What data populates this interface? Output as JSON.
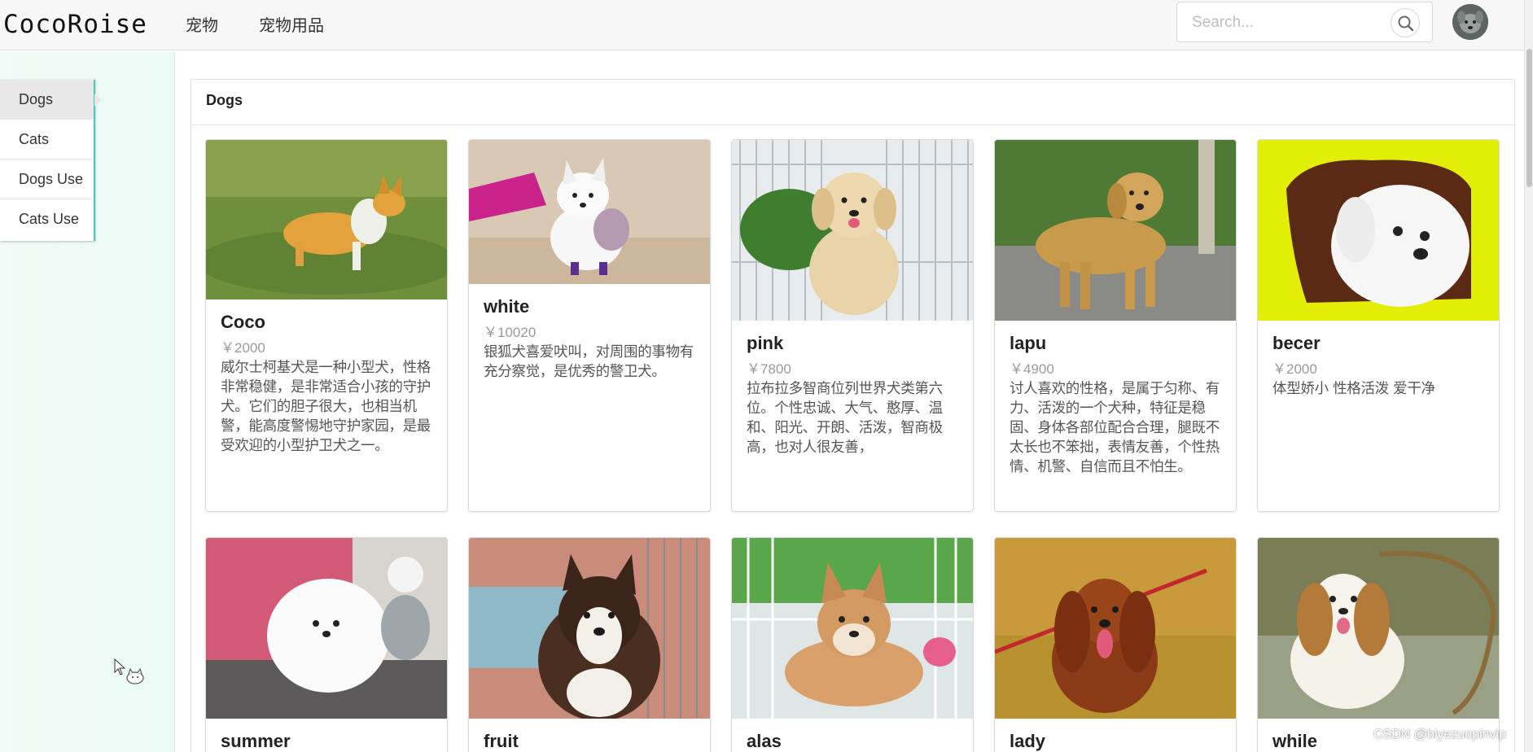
{
  "header": {
    "logo": "CocoRoise",
    "nav": [
      "宠物",
      "宠物用品"
    ],
    "search_placeholder": "Search..."
  },
  "sidebar": {
    "items": [
      {
        "label": "Dogs",
        "active": true
      },
      {
        "label": "Cats",
        "active": false
      },
      {
        "label": "Dogs Use",
        "active": false
      },
      {
        "label": "Cats Use",
        "active": false
      }
    ]
  },
  "main": {
    "title": "Dogs",
    "cards": [
      {
        "name": "Coco",
        "price": "￥2000",
        "desc": "威尔士柯基犬是一种小型犬，性格非常稳健，是非常适合小孩的守护犬。它们的胆子很大，也相当机警，能高度警惕地守护家园，是最受欢迎的小型护卫犬之一。",
        "photo": "corgi-photo"
      },
      {
        "name": "white",
        "price": "￥10020",
        "desc": "银狐犬喜爱吠叫，对周围的事物有充分察觉，是优秀的警卫犬。",
        "photo": "spitz-photo"
      },
      {
        "name": "pink",
        "price": "￥7800",
        "desc": "拉布拉多智商位列世界犬类第六位。个性忠诚、大气、憨厚、温和、阳光、开朗、活泼，智商极高，也对人很友善，",
        "photo": "labrador-puppy-photo"
      },
      {
        "name": "lapu",
        "price": "￥4900",
        "desc": "讨人喜欢的性格，是属于匀称、有力、活泼的一个犬种，特征是稳固、身体各部位配合合理，腿既不太长也不笨拙，表情友善，个性热情、机警、自信而且不怕生。",
        "photo": "golden-retriever-photo"
      },
      {
        "name": "becer",
        "price": "￥2000",
        "desc": "体型娇小 性格活泼 爱干净",
        "photo": "bichon-photo"
      },
      {
        "name": "summer",
        "price": "",
        "desc": "",
        "photo": "pomeranian-photo"
      },
      {
        "name": "fruit",
        "price": "",
        "desc": "",
        "photo": "malamute-photo"
      },
      {
        "name": "alas",
        "price": "",
        "desc": "",
        "photo": "shiba-photo"
      },
      {
        "name": "lady",
        "price": "",
        "desc": "",
        "photo": "cocker-spaniel-photo"
      },
      {
        "name": "while",
        "price": "",
        "desc": "",
        "photo": "cavalier-photo"
      }
    ]
  },
  "watermark": "CSDN @biyezuopinvip",
  "colors": {
    "accent": "#47c7c0",
    "sidebar_bg": "#eefaf5",
    "price": "#9a9a9a"
  }
}
